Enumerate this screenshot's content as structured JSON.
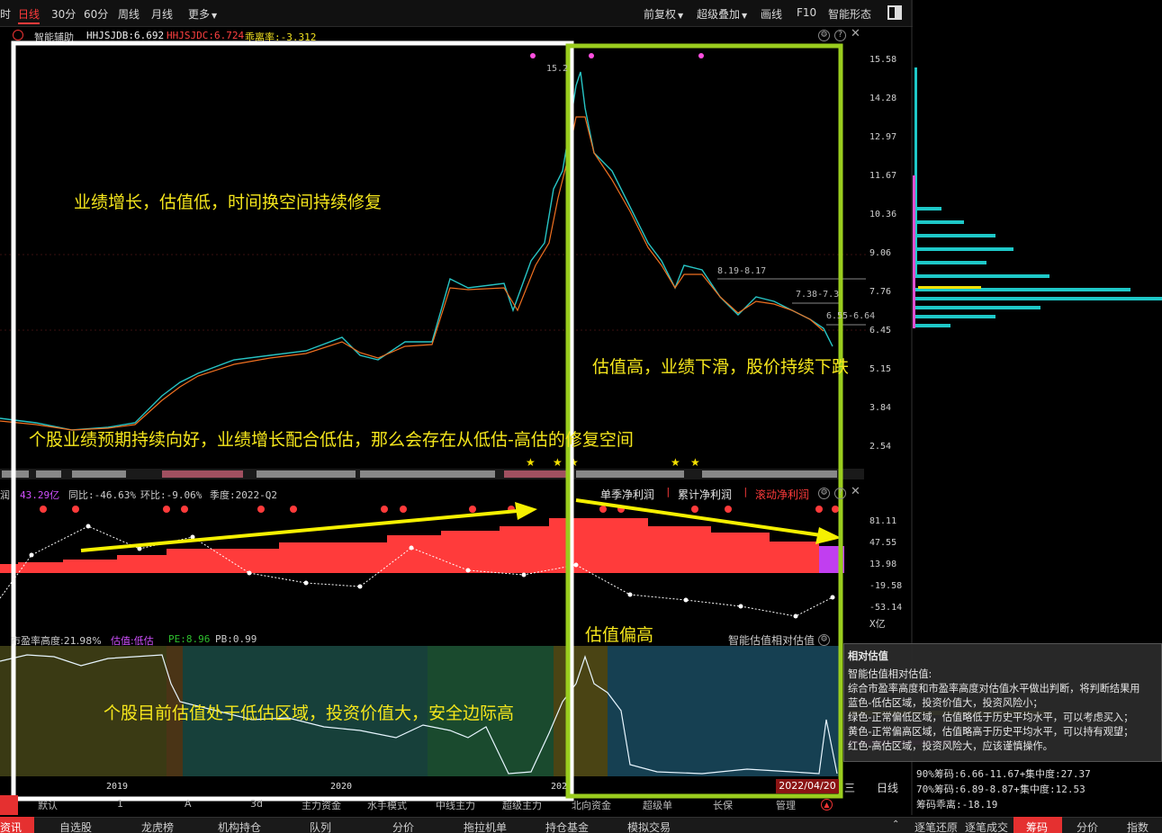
{
  "toolbar": {
    "left_items": [
      "时",
      "日线",
      "30分",
      "60分",
      "周线",
      "月线",
      "更多"
    ],
    "right_items": [
      "前复权",
      "超级叠加",
      "画线",
      "F10",
      "智能形态"
    ]
  },
  "main_indicator": {
    "name": "智能辅助",
    "hhjsjdb": "HHJSJDB:6.692",
    "hhjsjdc": "HHJSJDC:6.724",
    "deviation": "乖离率:-3.312"
  },
  "price_axis": [
    "15.58",
    "14.28",
    "12.97",
    "11.67",
    "10.36",
    "9.06",
    "7.76",
    "6.45",
    "5.15",
    "3.84",
    "2.54"
  ],
  "price_labels": {
    "peak": "15.2",
    "range1": "8.19-8.17",
    "range2": "7.38-7.3",
    "range3": "6.55-6.64"
  },
  "annotations": {
    "a1": "业绩增长，估值低，时间换空间持续修复",
    "a2": "估值高，业绩下滑，股价持续下跌",
    "a3": "个股业绩预期持续向好，业绩增长配合低估，那么会存在从低估-高估的修复空间",
    "a4": "估值偏高",
    "a5": "个股目前估值处于低估区域，投资价值大，安全边际高"
  },
  "profit_indicator": {
    "label_prefix": "润",
    "amount": "43.29亿",
    "yoy": "同比:-46.63%",
    "qoq": "环比:-9.06%",
    "quarter": "季度:2022-Q2",
    "tabs": [
      "单季净利润",
      "累计净利润",
      "滚动净利润"
    ],
    "axis": [
      "81.11",
      "47.55",
      "13.98",
      "-19.58",
      "-53.14"
    ],
    "unit": "X亿"
  },
  "valuation_indicator": {
    "pe_height": "市盈率高度:21.98%",
    "valuation": "估值:低估",
    "pe": "PE:8.96",
    "pb": "PB:0.99",
    "title": "智能估值相对估值"
  },
  "x_axis": [
    "2019",
    "2020",
    "202"
  ],
  "date_badge": "2022/04/20",
  "weekday": "三",
  "period": "日线",
  "tooltip": {
    "title": "相对估值",
    "lines": [
      "智能估值相对估值:",
      "综合市盈率高度和市盈率高度对估值水平做出判断，将判断结果用",
      "蓝色-低估区域，投资价值大，投资风险小；",
      "绿色-正常偏低区域，估值略低于历史平均水平，可以考虑买入；",
      "黄色-正常偏高区域，估值略高于历史平均水平，可以持有观望；",
      "红色-高估区域，投资风险大，应该谨慎操作。"
    ]
  },
  "chips": {
    "c90": "90%筹码:6.66-11.67+",
    "c90_conc": "集中度:27.37",
    "c70": "70%筹码:6.89-8.87+",
    "c70_conc": "集中度:12.53",
    "deviation": "筹码乖离:-18.19"
  },
  "bottom_tabs_1": [
    "默认",
    "1",
    "A",
    "3d",
    "主力资金",
    "水手模式",
    "中线主力",
    "超级主力",
    "北向资金",
    "超级单",
    "长保",
    "管理"
  ],
  "bottom_tabs_2": [
    "资讯",
    "自选股",
    "龙虎榜",
    "机构持仓",
    "队列",
    "分价",
    "拖拉机单",
    "持仓基金",
    "模拟交易"
  ],
  "bottom_tabs_right": [
    "逐笔还原",
    "逐笔成交",
    "筹码",
    "分价",
    "指数"
  ],
  "colors": {
    "accent_red": "#ff3b3b",
    "annotation_yellow": "#f5e61c",
    "frame_white": "#ffffff",
    "frame_green": "#9acd1e",
    "bar_red": "#ff3b3b",
    "chip_cyan": "#1ec8c8"
  }
}
